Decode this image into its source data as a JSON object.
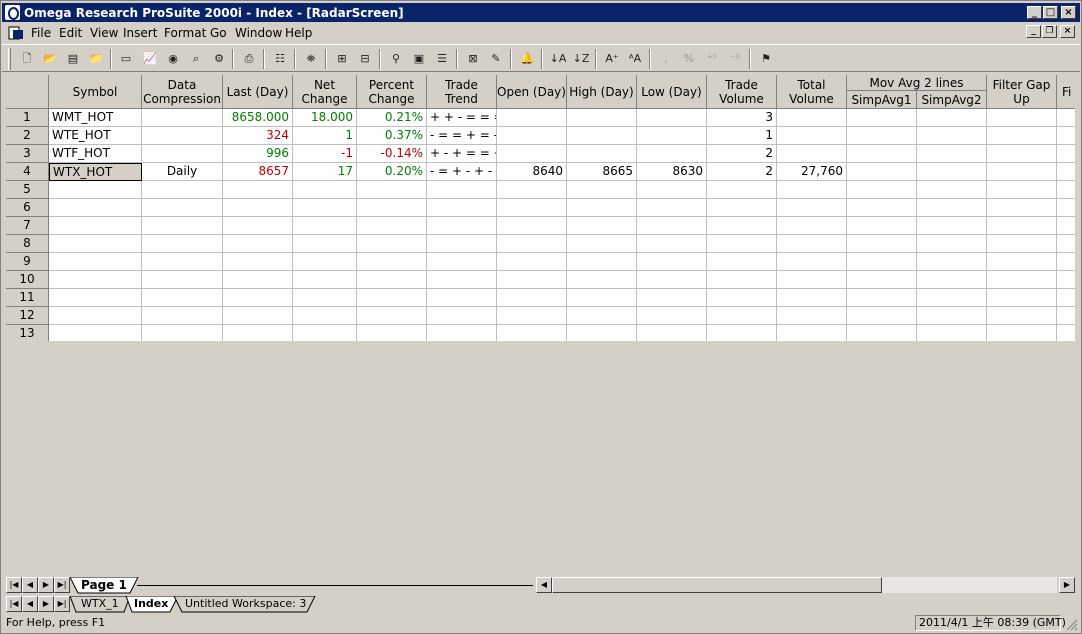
{
  "window": {
    "title": "Omega Research ProSuite 2000i - Index - [RadarScreen]"
  },
  "menu": [
    "File",
    "Edit",
    "View",
    "Insert",
    "Format",
    "Go",
    "Window",
    "Help"
  ],
  "grid": {
    "headers": {
      "symbol": "Symbol",
      "data_compression": [
        "Data",
        "Compression"
      ],
      "last_day": "Last (Day)",
      "net_change": [
        "Net",
        "Change"
      ],
      "percent_change": [
        "Percent",
        "Change"
      ],
      "trade_trend": [
        "Trade",
        "Trend"
      ],
      "open_day": "Open (Day)",
      "high_day": "High (Day)",
      "low_day": "Low (Day)",
      "trade_volume": [
        "Trade",
        "Volume"
      ],
      "total_volume": [
        "Total",
        "Volume"
      ],
      "mov_avg_group": "Mov Avg 2 lines",
      "simp_avg1": "SimpAvg1",
      "simp_avg2": "SimpAvg2",
      "filter_gap": [
        "Filter Gap",
        "Up"
      ],
      "next": "Fi"
    },
    "row_numbers": [
      "1",
      "2",
      "3",
      "4",
      "5",
      "6",
      "7",
      "8",
      "9",
      "10",
      "11",
      "12",
      "13"
    ],
    "rows": [
      {
        "symbol": "WMT_HOT",
        "compression": "",
        "last": "8658.000",
        "last_color": "green",
        "net": "18.000",
        "net_color": "green",
        "pct": "0.21%",
        "pct_color": "green",
        "trend": "+ + - = = = =",
        "open": "",
        "high": "",
        "low": "",
        "tvol": "3",
        "totvol": ""
      },
      {
        "symbol": "WTE_HOT",
        "compression": "",
        "last": "324",
        "last_color": "red",
        "net": "1",
        "net_color": "green",
        "pct": "0.37%",
        "pct_color": "green",
        "trend": "- = = + = - -",
        "open": "",
        "high": "",
        "low": "",
        "tvol": "1",
        "totvol": ""
      },
      {
        "symbol": "WTF_HOT",
        "compression": "",
        "last": "996",
        "last_color": "green",
        "net": "-1",
        "net_color": "red",
        "pct": "-0.14%",
        "pct_color": "red",
        "trend": "+ - + = = + =",
        "open": "",
        "high": "",
        "low": "",
        "tvol": "2",
        "totvol": ""
      },
      {
        "symbol": "WTX_HOT",
        "compression": "Daily",
        "last": "8657",
        "last_color": "red",
        "net": "17",
        "net_color": "green",
        "pct": "0.20%",
        "pct_color": "green",
        "trend": "- = + - + - =",
        "open": "8640",
        "high": "8665",
        "low": "8630",
        "tvol": "2",
        "totvol": "27,760"
      }
    ]
  },
  "page_tab": "Page 1",
  "workspace_tabs": [
    "WTX_1",
    "Index",
    "Untitled Workspace:  3"
  ],
  "status": {
    "help": "For Help, press F1",
    "datetime": "2011/4/1 上午 08:39 (GMT)"
  },
  "colors": {
    "titlebar": "#0a246a",
    "positive": "#008000",
    "negative": "#c00000",
    "chrome": "#d4d0c8"
  }
}
